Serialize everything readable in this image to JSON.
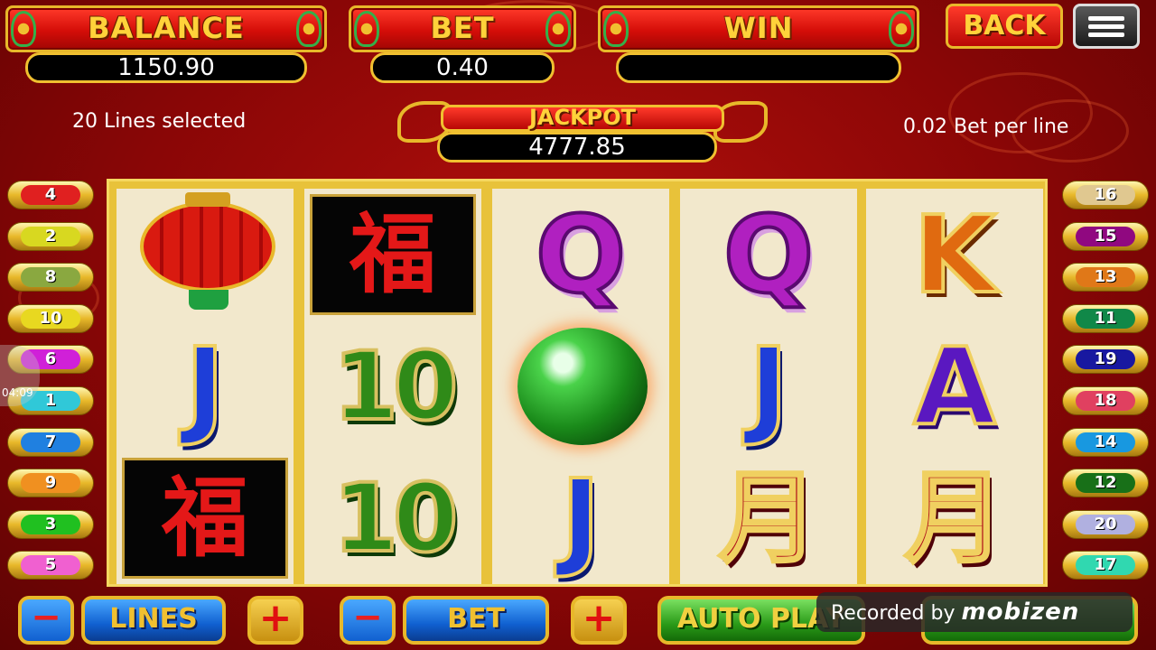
{
  "header": {
    "balance_label": "BALANCE",
    "balance_value": "1150.90",
    "bet_label": "BET",
    "bet_value": "0.40",
    "win_label": "WIN",
    "win_value": "",
    "back_label": "BACK",
    "menu_icon": "hamburger-menu-icon"
  },
  "info": {
    "lines_selected": "20 Lines selected",
    "bet_per_line": "0.02 Bet per line"
  },
  "jackpot": {
    "label": "JACKPOT",
    "value": "4777.85"
  },
  "reels": [
    {
      "symbols": [
        "lantern",
        "J",
        "fu"
      ]
    },
    {
      "symbols": [
        "fu",
        "10",
        "10"
      ]
    },
    {
      "symbols": [
        "Q",
        "jade-orb",
        "J"
      ]
    },
    {
      "symbols": [
        "Q",
        "J",
        "A-glyph"
      ]
    },
    {
      "symbols": [
        "K",
        "A",
        "A-glyph"
      ]
    }
  ],
  "symbol_text": {
    "Q": "Q",
    "J": "J",
    "10": "10",
    "K": "K",
    "A": "A",
    "A-glyph": "月",
    "fu": "福"
  },
  "left_lines": [
    {
      "num": "4",
      "color": "#e02020"
    },
    {
      "num": "2",
      "color": "#d8d820"
    },
    {
      "num": "8",
      "color": "#8aa840"
    },
    {
      "num": "10",
      "color": "#e8d820"
    },
    {
      "num": "6",
      "color": "#d020d8"
    },
    {
      "num": "1",
      "color": "#30c8d8"
    },
    {
      "num": "7",
      "color": "#2080e0"
    },
    {
      "num": "9",
      "color": "#f09020"
    },
    {
      "num": "3",
      "color": "#20c020"
    },
    {
      "num": "5",
      "color": "#f060d0"
    }
  ],
  "right_lines": [
    {
      "num": "16",
      "color": "#e0c890"
    },
    {
      "num": "15",
      "color": "#900880"
    },
    {
      "num": "13",
      "color": "#e07818"
    },
    {
      "num": "11",
      "color": "#108848"
    },
    {
      "num": "19",
      "color": "#1818a0"
    },
    {
      "num": "18",
      "color": "#e04060"
    },
    {
      "num": "14",
      "color": "#1898e0"
    },
    {
      "num": "12",
      "color": "#187018"
    },
    {
      "num": "20",
      "color": "#b0b0e0"
    },
    {
      "num": "17",
      "color": "#30d8b0"
    }
  ],
  "controls": {
    "lines_minus": "−",
    "lines_label": "LINES",
    "lines_plus": "+",
    "bet_minus": "−",
    "bet_label": "BET",
    "bet_plus": "+",
    "autoplay_label": "AUTO PLAY"
  },
  "overlay": {
    "recorded_by": "Recorded by",
    "brand": "mobizen",
    "time": "04:09"
  }
}
